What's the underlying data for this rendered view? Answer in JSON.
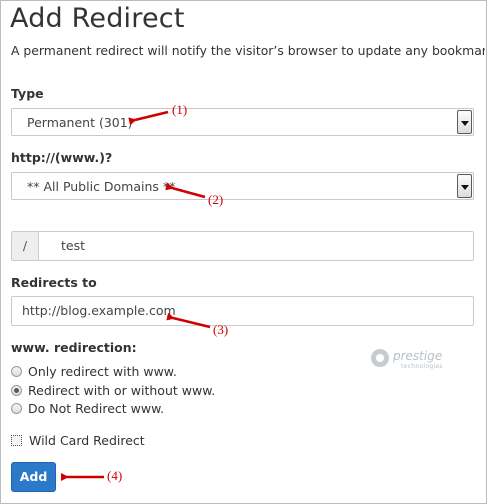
{
  "page": {
    "title": "Add Redirect",
    "description": "A permanent redirect will notify the visitor’s browser to update any bookmarks that"
  },
  "type_field": {
    "label": "Type",
    "selected": "Permanent (301)"
  },
  "domain_field": {
    "label": "http://(www.)?",
    "selected": "** All Public Domains **"
  },
  "path_field": {
    "prefix": "/",
    "value": "test"
  },
  "redirects_to": {
    "label": "Redirects to",
    "value": "http://blog.example.com"
  },
  "www_redirection": {
    "label": "www. redirection:",
    "options": [
      {
        "label": "Only redirect with www.",
        "checked": false
      },
      {
        "label": "Redirect with or without www.",
        "checked": true
      },
      {
        "label": "Do Not Redirect www.",
        "checked": false
      }
    ]
  },
  "wildcard": {
    "label": "Wild Card Redirect",
    "checked": false
  },
  "submit": {
    "label": "Add",
    "color": "#2b7ac9"
  },
  "annotations": {
    "a1": "(1)",
    "a2": "(2)",
    "a3": "(3)",
    "a4": "(4)",
    "color": "#d10000"
  },
  "watermark": {
    "brand": "prestige",
    "tagline": "technologies"
  }
}
